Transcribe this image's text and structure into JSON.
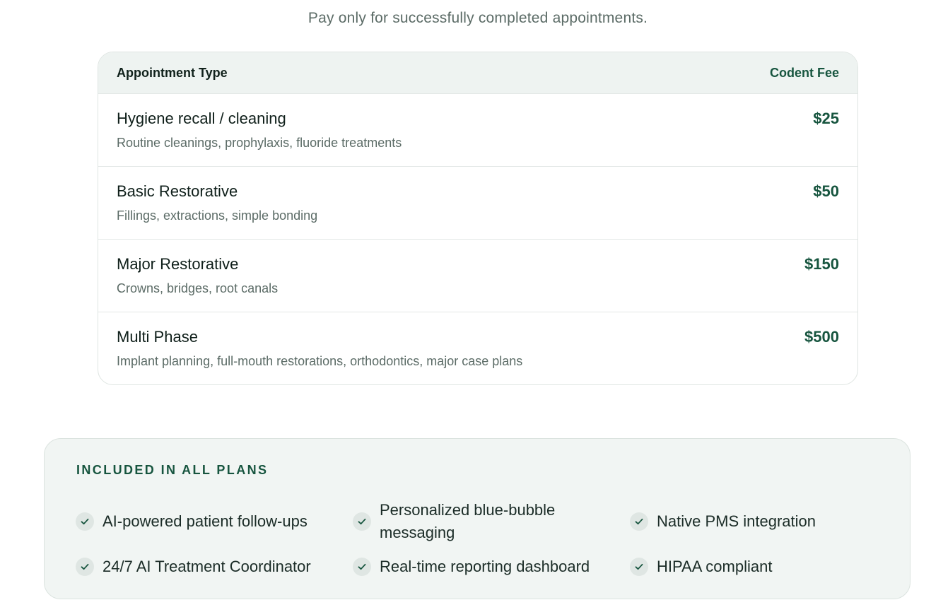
{
  "subtitle": "Pay only for successfully completed appointments.",
  "table": {
    "header_type": "Appointment Type",
    "header_fee": "Codent Fee",
    "rows": [
      {
        "title": "Hygiene recall / cleaning",
        "description": "Routine cleanings, prophylaxis, fluoride treatments",
        "fee": "$25"
      },
      {
        "title": "Basic Restorative",
        "description": "Fillings, extractions, simple bonding",
        "fee": "$50"
      },
      {
        "title": "Major Restorative",
        "description": "Crowns, bridges, root canals",
        "fee": "$150"
      },
      {
        "title": "Multi Phase",
        "description": "Implant planning, full-mouth restorations, orthodontics, major case plans",
        "fee": "$500"
      }
    ]
  },
  "plans": {
    "heading": "INCLUDED IN ALL PLANS",
    "features": [
      "AI-powered patient follow-ups",
      "Personalized blue-bubble messaging",
      "Native PMS integration",
      "24/7 AI Treatment Coordinator",
      "Real-time reporting dashboard",
      "HIPAA compliant"
    ],
    "check_icon": "check-icon"
  },
  "colors": {
    "accent": "#17553f",
    "header_bg": "#eef3f1",
    "card_bg": "#f1f5f3",
    "muted_text": "#5b6b66"
  }
}
